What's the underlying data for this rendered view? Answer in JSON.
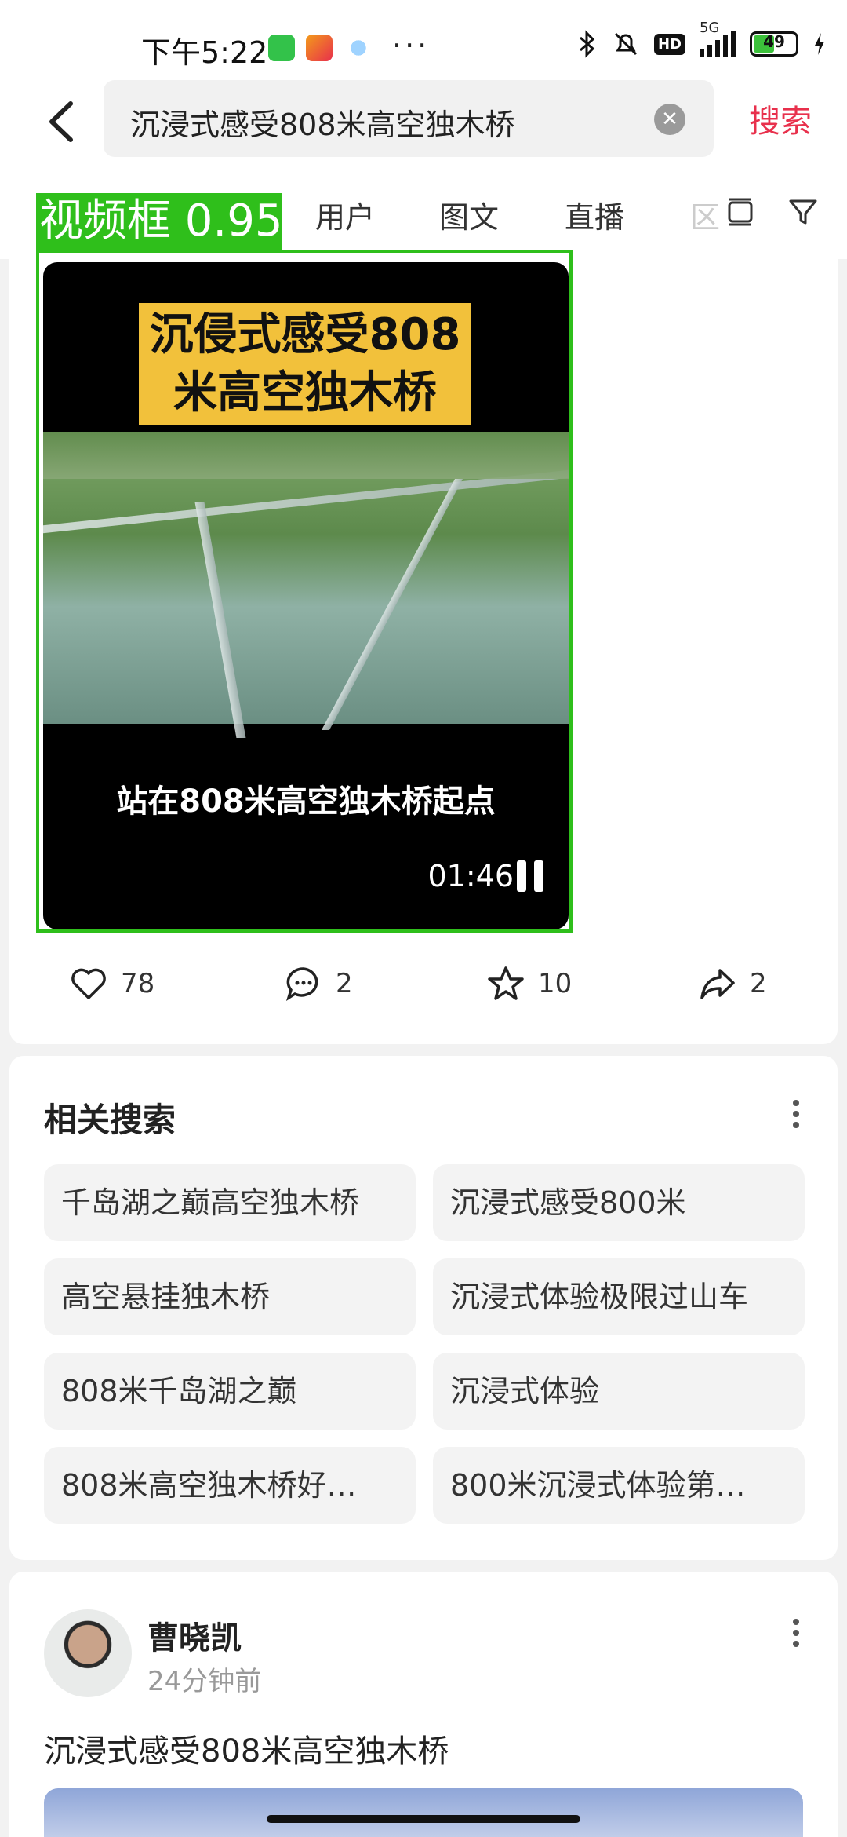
{
  "status_bar": {
    "time": "下午5:22",
    "dots": "···",
    "network": "5G",
    "hd": "HD",
    "battery": "49"
  },
  "header": {
    "query": "沉浸式感受808米高空独木桥",
    "search_label": "搜索"
  },
  "tabs": [
    "用户",
    "图文",
    "直播",
    "区"
  ],
  "detection": {
    "label": "视频框 0.95"
  },
  "video": {
    "banner_line1": "沉侵式感受808",
    "banner_line2": "米高空独木桥",
    "subtitle": "站在808米高空独木桥起点",
    "duration": "01:46"
  },
  "actions": {
    "likes": "78",
    "comments": "2",
    "favorites": "10",
    "shares": "2"
  },
  "related": {
    "title": "相关搜索",
    "items": [
      "千岛湖之巅高空独木桥",
      "沉浸式感受800米",
      "高空悬挂独木桥",
      "沉浸式体验极限过山车",
      "808米千岛湖之巅",
      "沉浸式体验",
      "808米高空独木桥好…",
      "800米沉浸式体验第…"
    ]
  },
  "post": {
    "author": "曹晓凯",
    "time": "24分钟前",
    "text": "沉浸式感受808米高空独木桥"
  },
  "colors": {
    "accent": "#e8304c",
    "detection": "#2fbf1b",
    "banner": "#f2c13b"
  }
}
